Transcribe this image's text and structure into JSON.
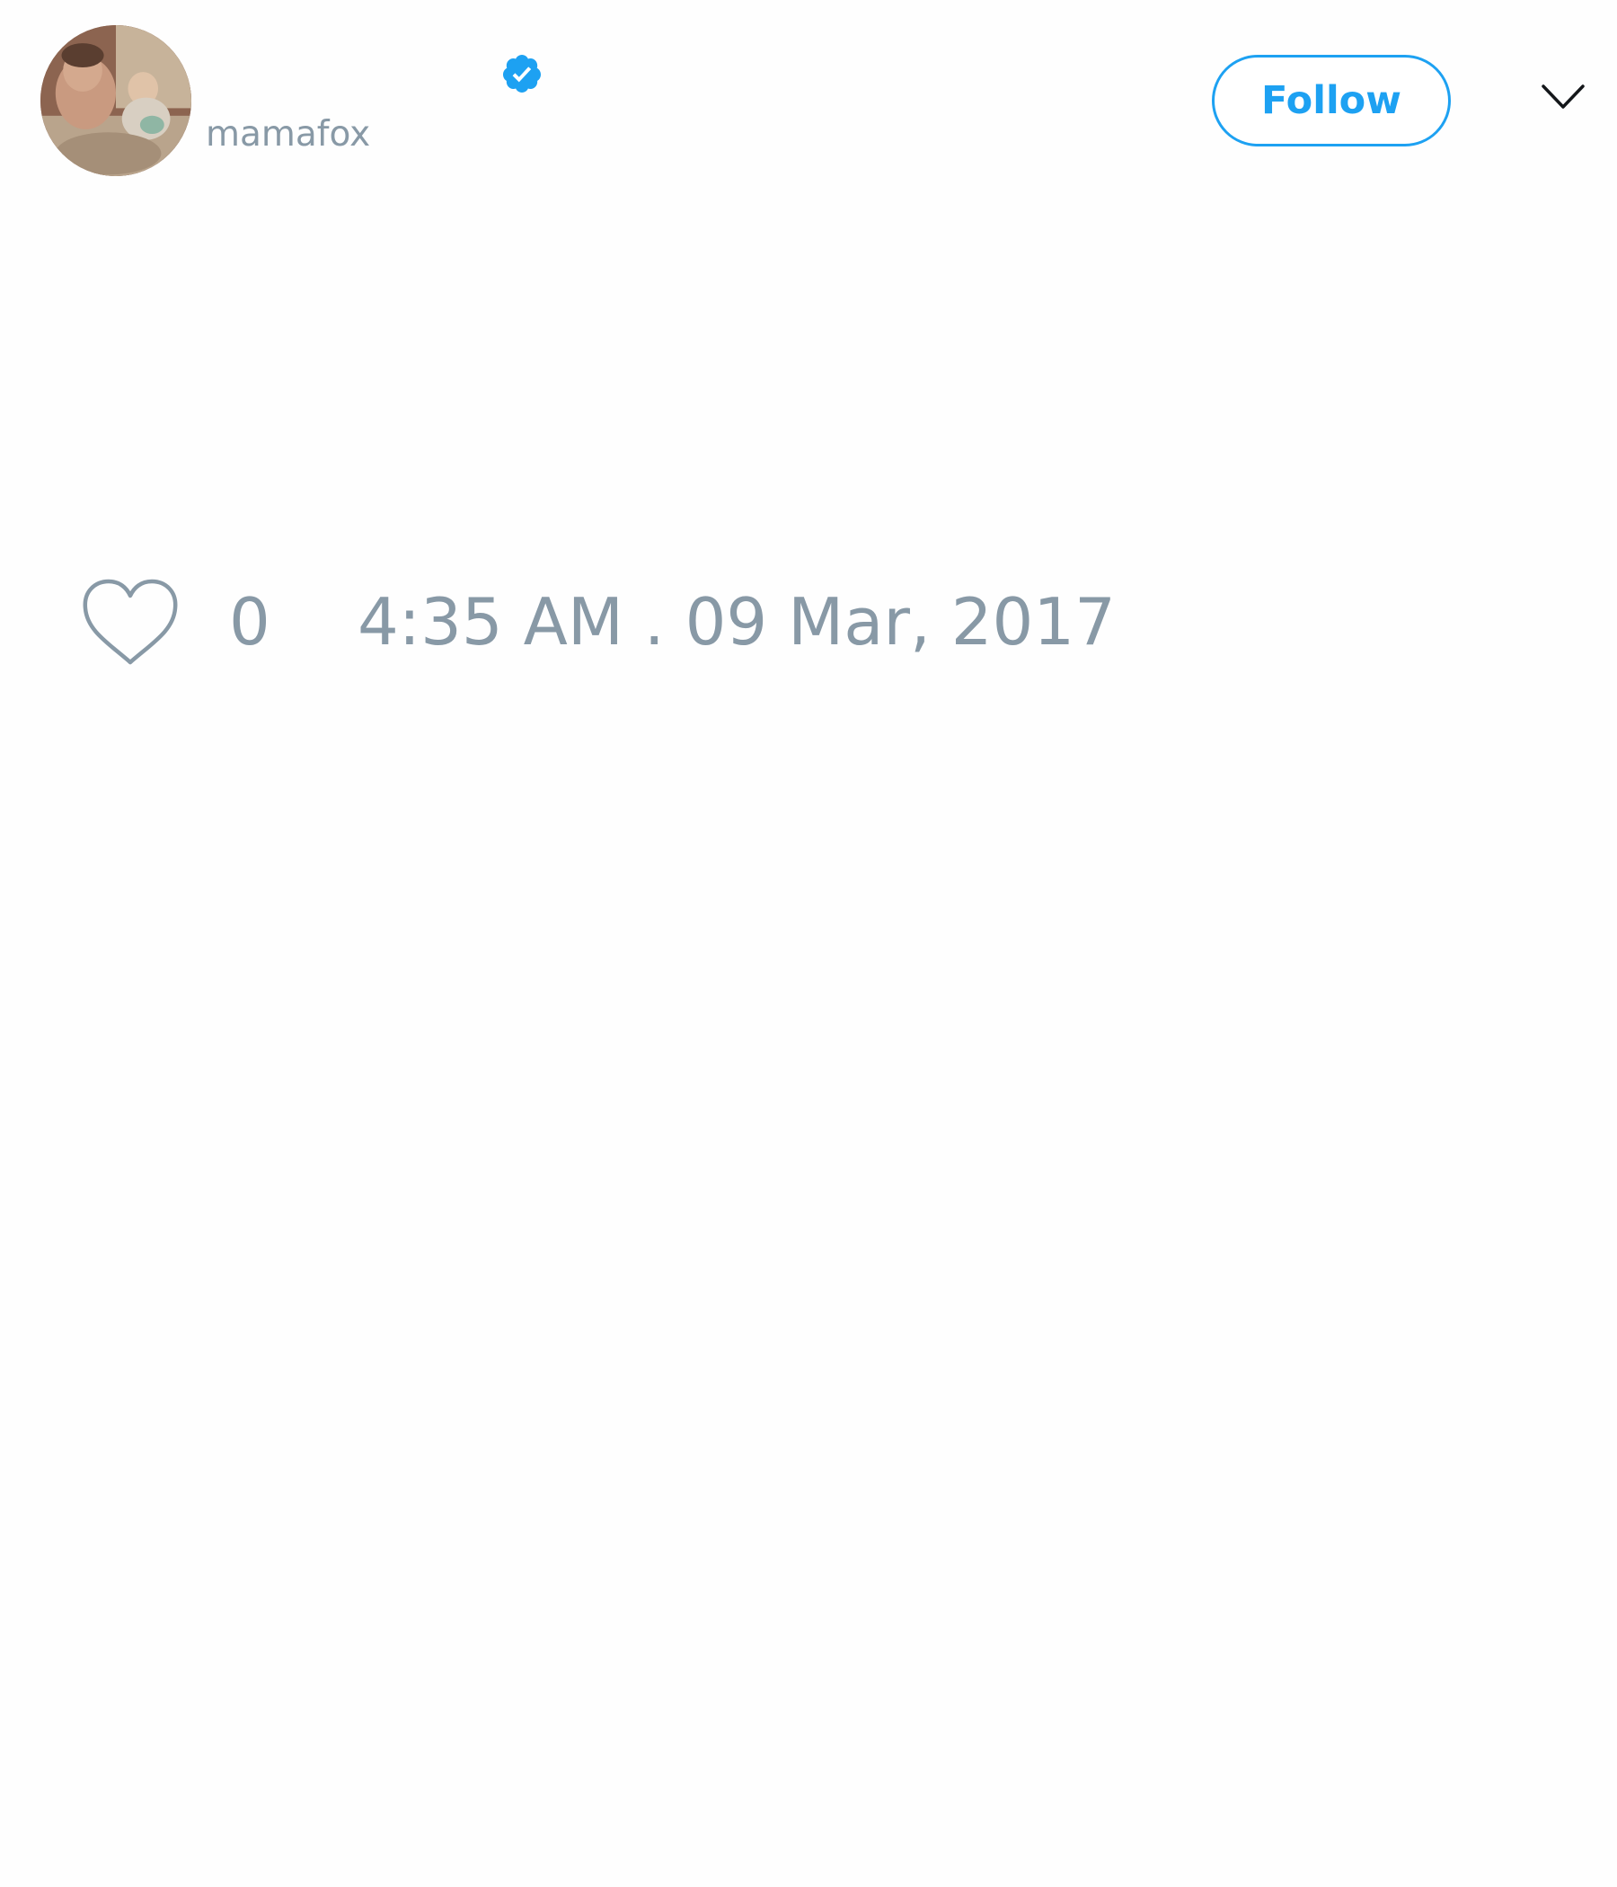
{
  "tweet": {
    "user": {
      "avatar": "avatar-photo",
      "handle": "mamafox",
      "verified_icon": "verified-badge-icon"
    },
    "header": {
      "follow_label": "Follow",
      "menu_icon": "chevron-down-icon"
    },
    "footer": {
      "like_icon": "heart-icon",
      "like_count": "0",
      "timestamp": "4:35 AM . 09 Mar, 2017"
    }
  },
  "colors": {
    "accent": "#1da1f2",
    "muted_text": "#8899a6",
    "background": "#fefefe"
  }
}
